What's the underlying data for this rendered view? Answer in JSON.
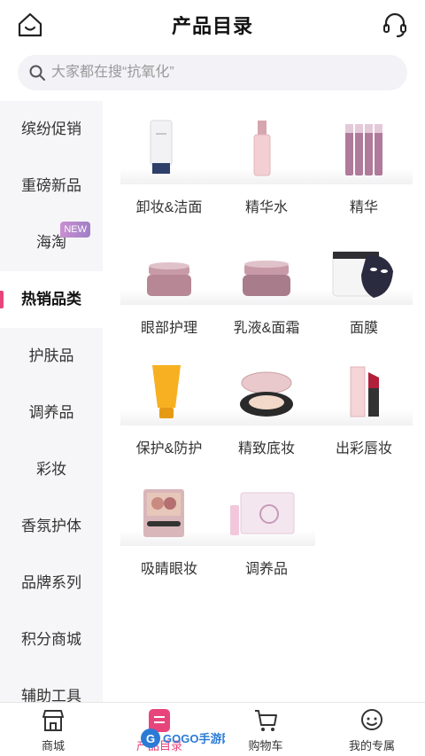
{
  "header": {
    "title": "产品目录",
    "home_icon": "home-icon",
    "support_icon": "headset-icon"
  },
  "search": {
    "placeholder": "大家都在搜“抗氧化”",
    "icon": "search-icon"
  },
  "sidebar": {
    "items": [
      {
        "label": "缤纷促销",
        "active": false
      },
      {
        "label": "重磅新品",
        "active": false
      },
      {
        "label": "海淘",
        "active": false,
        "badge": "NEW"
      },
      {
        "label": "热销品类",
        "active": true
      },
      {
        "label": "护肤品",
        "active": false
      },
      {
        "label": "调养品",
        "active": false
      },
      {
        "label": "彩妆",
        "active": false
      },
      {
        "label": "香氛护体",
        "active": false
      },
      {
        "label": "品牌系列",
        "active": false
      },
      {
        "label": "积分商城",
        "active": false
      },
      {
        "label": "辅助工具",
        "active": false
      }
    ]
  },
  "categories": [
    {
      "label": "卸妆&洁面",
      "icon": "cleanser-tube-icon"
    },
    {
      "label": "精华水",
      "icon": "toner-bottle-icon"
    },
    {
      "label": "精华",
      "icon": "serum-vials-icon"
    },
    {
      "label": "眼部护理",
      "icon": "eye-cream-jar-icon"
    },
    {
      "label": "乳液&面霜",
      "icon": "face-cream-jar-icon"
    },
    {
      "label": "面膜",
      "icon": "face-mask-icon"
    },
    {
      "label": "保护&防护",
      "icon": "sunscreen-tube-icon"
    },
    {
      "label": "精致底妆",
      "icon": "cushion-compact-icon"
    },
    {
      "label": "出彩唇妆",
      "icon": "lipstick-icon"
    },
    {
      "label": "吸睛眼妆",
      "icon": "eyeshadow-palette-icon"
    },
    {
      "label": "调养品",
      "icon": "supplement-box-icon"
    }
  ],
  "bottom_nav": [
    {
      "label": "商城",
      "icon": "store-icon",
      "active": false
    },
    {
      "label": "产品目录",
      "icon": "catalog-icon",
      "active": true
    },
    {
      "label": "购物车",
      "icon": "cart-icon",
      "active": false
    },
    {
      "label": "我的专属",
      "icon": "profile-icon",
      "active": false
    }
  ],
  "colors": {
    "accent": "#e8447c",
    "sidebar_bg": "#f6f6f8",
    "search_bg": "#f3f2f6"
  }
}
